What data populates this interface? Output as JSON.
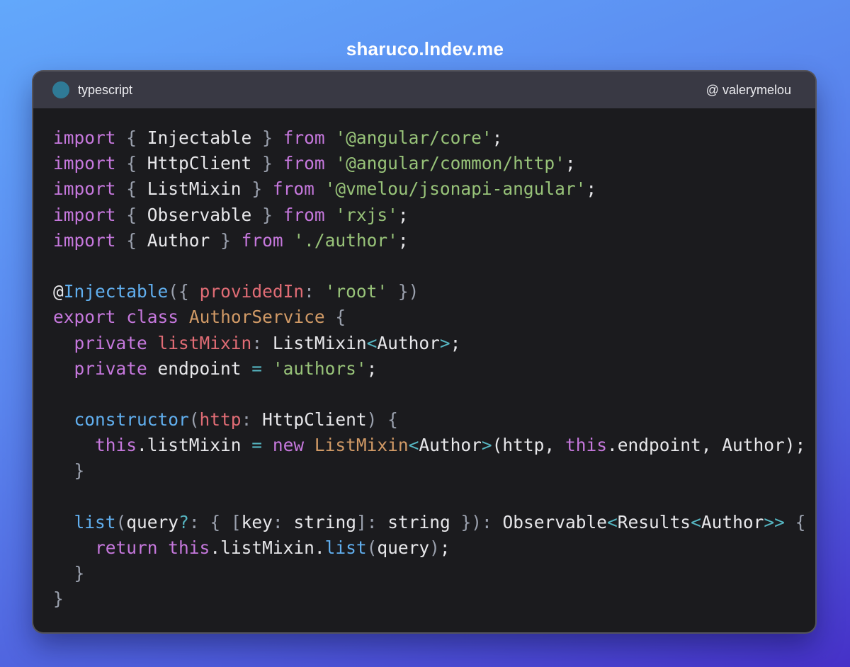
{
  "header": {
    "site": "sharuco.lndev.me"
  },
  "window": {
    "language": "typescript",
    "author_handle": "@ valerymelou"
  },
  "colors": {
    "keyword": "#c678dd",
    "string": "#98c379",
    "function": "#61afef",
    "class": "#d19a66",
    "property": "#e06c75",
    "operator": "#56b6c2",
    "punctuation": "#9aa0ad",
    "text": "#e7e7ea",
    "language_dot": "#2f7a96"
  },
  "code_lines": [
    [
      [
        "kw",
        "import"
      ],
      [
        "plain",
        " "
      ],
      [
        "punc",
        "{"
      ],
      [
        "plain",
        " Injectable "
      ],
      [
        "punc",
        "}"
      ],
      [
        "plain",
        " "
      ],
      [
        "kw",
        "from"
      ],
      [
        "plain",
        " "
      ],
      [
        "str",
        "'@angular/core'"
      ],
      [
        "plain",
        ";"
      ]
    ],
    [
      [
        "kw",
        "import"
      ],
      [
        "plain",
        " "
      ],
      [
        "punc",
        "{"
      ],
      [
        "plain",
        " HttpClient "
      ],
      [
        "punc",
        "}"
      ],
      [
        "plain",
        " "
      ],
      [
        "kw",
        "from"
      ],
      [
        "plain",
        " "
      ],
      [
        "str",
        "'@angular/common/http'"
      ],
      [
        "plain",
        ";"
      ]
    ],
    [
      [
        "kw",
        "import"
      ],
      [
        "plain",
        " "
      ],
      [
        "punc",
        "{"
      ],
      [
        "plain",
        " ListMixin "
      ],
      [
        "punc",
        "}"
      ],
      [
        "plain",
        " "
      ],
      [
        "kw",
        "from"
      ],
      [
        "plain",
        " "
      ],
      [
        "str",
        "'@vmelou/jsonapi-angular'"
      ],
      [
        "plain",
        ";"
      ]
    ],
    [
      [
        "kw",
        "import"
      ],
      [
        "plain",
        " "
      ],
      [
        "punc",
        "{"
      ],
      [
        "plain",
        " Observable "
      ],
      [
        "punc",
        "}"
      ],
      [
        "plain",
        " "
      ],
      [
        "kw",
        "from"
      ],
      [
        "plain",
        " "
      ],
      [
        "str",
        "'rxjs'"
      ],
      [
        "plain",
        ";"
      ]
    ],
    [
      [
        "kw",
        "import"
      ],
      [
        "plain",
        " "
      ],
      [
        "punc",
        "{"
      ],
      [
        "plain",
        " Author "
      ],
      [
        "punc",
        "}"
      ],
      [
        "plain",
        " "
      ],
      [
        "kw",
        "from"
      ],
      [
        "plain",
        " "
      ],
      [
        "str",
        "'./author'"
      ],
      [
        "plain",
        ";"
      ]
    ],
    [],
    [
      [
        "plain",
        "@"
      ],
      [
        "fn",
        "Injectable"
      ],
      [
        "punc",
        "({"
      ],
      [
        "plain",
        " "
      ],
      [
        "prop",
        "providedIn"
      ],
      [
        "punc",
        ":"
      ],
      [
        "plain",
        " "
      ],
      [
        "str",
        "'root'"
      ],
      [
        "plain",
        " "
      ],
      [
        "punc",
        "})"
      ]
    ],
    [
      [
        "kw",
        "export"
      ],
      [
        "plain",
        " "
      ],
      [
        "kw",
        "class"
      ],
      [
        "plain",
        " "
      ],
      [
        "cls",
        "AuthorService"
      ],
      [
        "plain",
        " "
      ],
      [
        "punc",
        "{"
      ]
    ],
    [
      [
        "plain",
        "  "
      ],
      [
        "kw",
        "private"
      ],
      [
        "plain",
        " "
      ],
      [
        "prop",
        "listMixin"
      ],
      [
        "punc",
        ":"
      ],
      [
        "plain",
        " ListMixin"
      ],
      [
        "op",
        "<"
      ],
      [
        "plain",
        "Author"
      ],
      [
        "op",
        ">"
      ],
      [
        "plain",
        ";"
      ]
    ],
    [
      [
        "plain",
        "  "
      ],
      [
        "kw",
        "private"
      ],
      [
        "plain",
        " endpoint "
      ],
      [
        "op",
        "="
      ],
      [
        "plain",
        " "
      ],
      [
        "str",
        "'authors'"
      ],
      [
        "plain",
        ";"
      ]
    ],
    [],
    [
      [
        "plain",
        "  "
      ],
      [
        "fn",
        "constructor"
      ],
      [
        "punc",
        "("
      ],
      [
        "prop",
        "http"
      ],
      [
        "punc",
        ":"
      ],
      [
        "plain",
        " HttpClient"
      ],
      [
        "punc",
        ")"
      ],
      [
        "plain",
        " "
      ],
      [
        "punc",
        "{"
      ]
    ],
    [
      [
        "plain",
        "    "
      ],
      [
        "kw",
        "this"
      ],
      [
        "plain",
        ".listMixin "
      ],
      [
        "op",
        "="
      ],
      [
        "plain",
        " "
      ],
      [
        "kw",
        "new"
      ],
      [
        "plain",
        " "
      ],
      [
        "cls",
        "ListMixin"
      ],
      [
        "op",
        "<"
      ],
      [
        "plain",
        "Author"
      ],
      [
        "op",
        ">"
      ],
      [
        "plain",
        "(http, "
      ],
      [
        "kw",
        "this"
      ],
      [
        "plain",
        ".endpoint, Author);"
      ]
    ],
    [
      [
        "plain",
        "  "
      ],
      [
        "punc",
        "}"
      ]
    ],
    [],
    [
      [
        "plain",
        "  "
      ],
      [
        "fn",
        "list"
      ],
      [
        "punc",
        "("
      ],
      [
        "plain",
        "query"
      ],
      [
        "op",
        "?"
      ],
      [
        "punc",
        ":"
      ],
      [
        "plain",
        " "
      ],
      [
        "punc",
        "{"
      ],
      [
        "plain",
        " "
      ],
      [
        "punc",
        "["
      ],
      [
        "plain",
        "key"
      ],
      [
        "punc",
        ":"
      ],
      [
        "plain",
        " string"
      ],
      [
        "punc",
        "]:"
      ],
      [
        "plain",
        " string "
      ],
      [
        "punc",
        "})"
      ],
      [
        "punc",
        ":"
      ],
      [
        "plain",
        " Observable"
      ],
      [
        "op",
        "<"
      ],
      [
        "plain",
        "Results"
      ],
      [
        "op",
        "<"
      ],
      [
        "plain",
        "Author"
      ],
      [
        "op",
        ">>"
      ],
      [
        "plain",
        " "
      ],
      [
        "punc",
        "{"
      ]
    ],
    [
      [
        "plain",
        "    "
      ],
      [
        "kw",
        "return"
      ],
      [
        "plain",
        " "
      ],
      [
        "kw",
        "this"
      ],
      [
        "plain",
        ".listMixin."
      ],
      [
        "fn",
        "list"
      ],
      [
        "punc",
        "("
      ],
      [
        "plain",
        "query"
      ],
      [
        "punc",
        ")"
      ],
      [
        "plain",
        ";"
      ]
    ],
    [
      [
        "plain",
        "  "
      ],
      [
        "punc",
        "}"
      ]
    ],
    [
      [
        "punc",
        "}"
      ]
    ]
  ]
}
